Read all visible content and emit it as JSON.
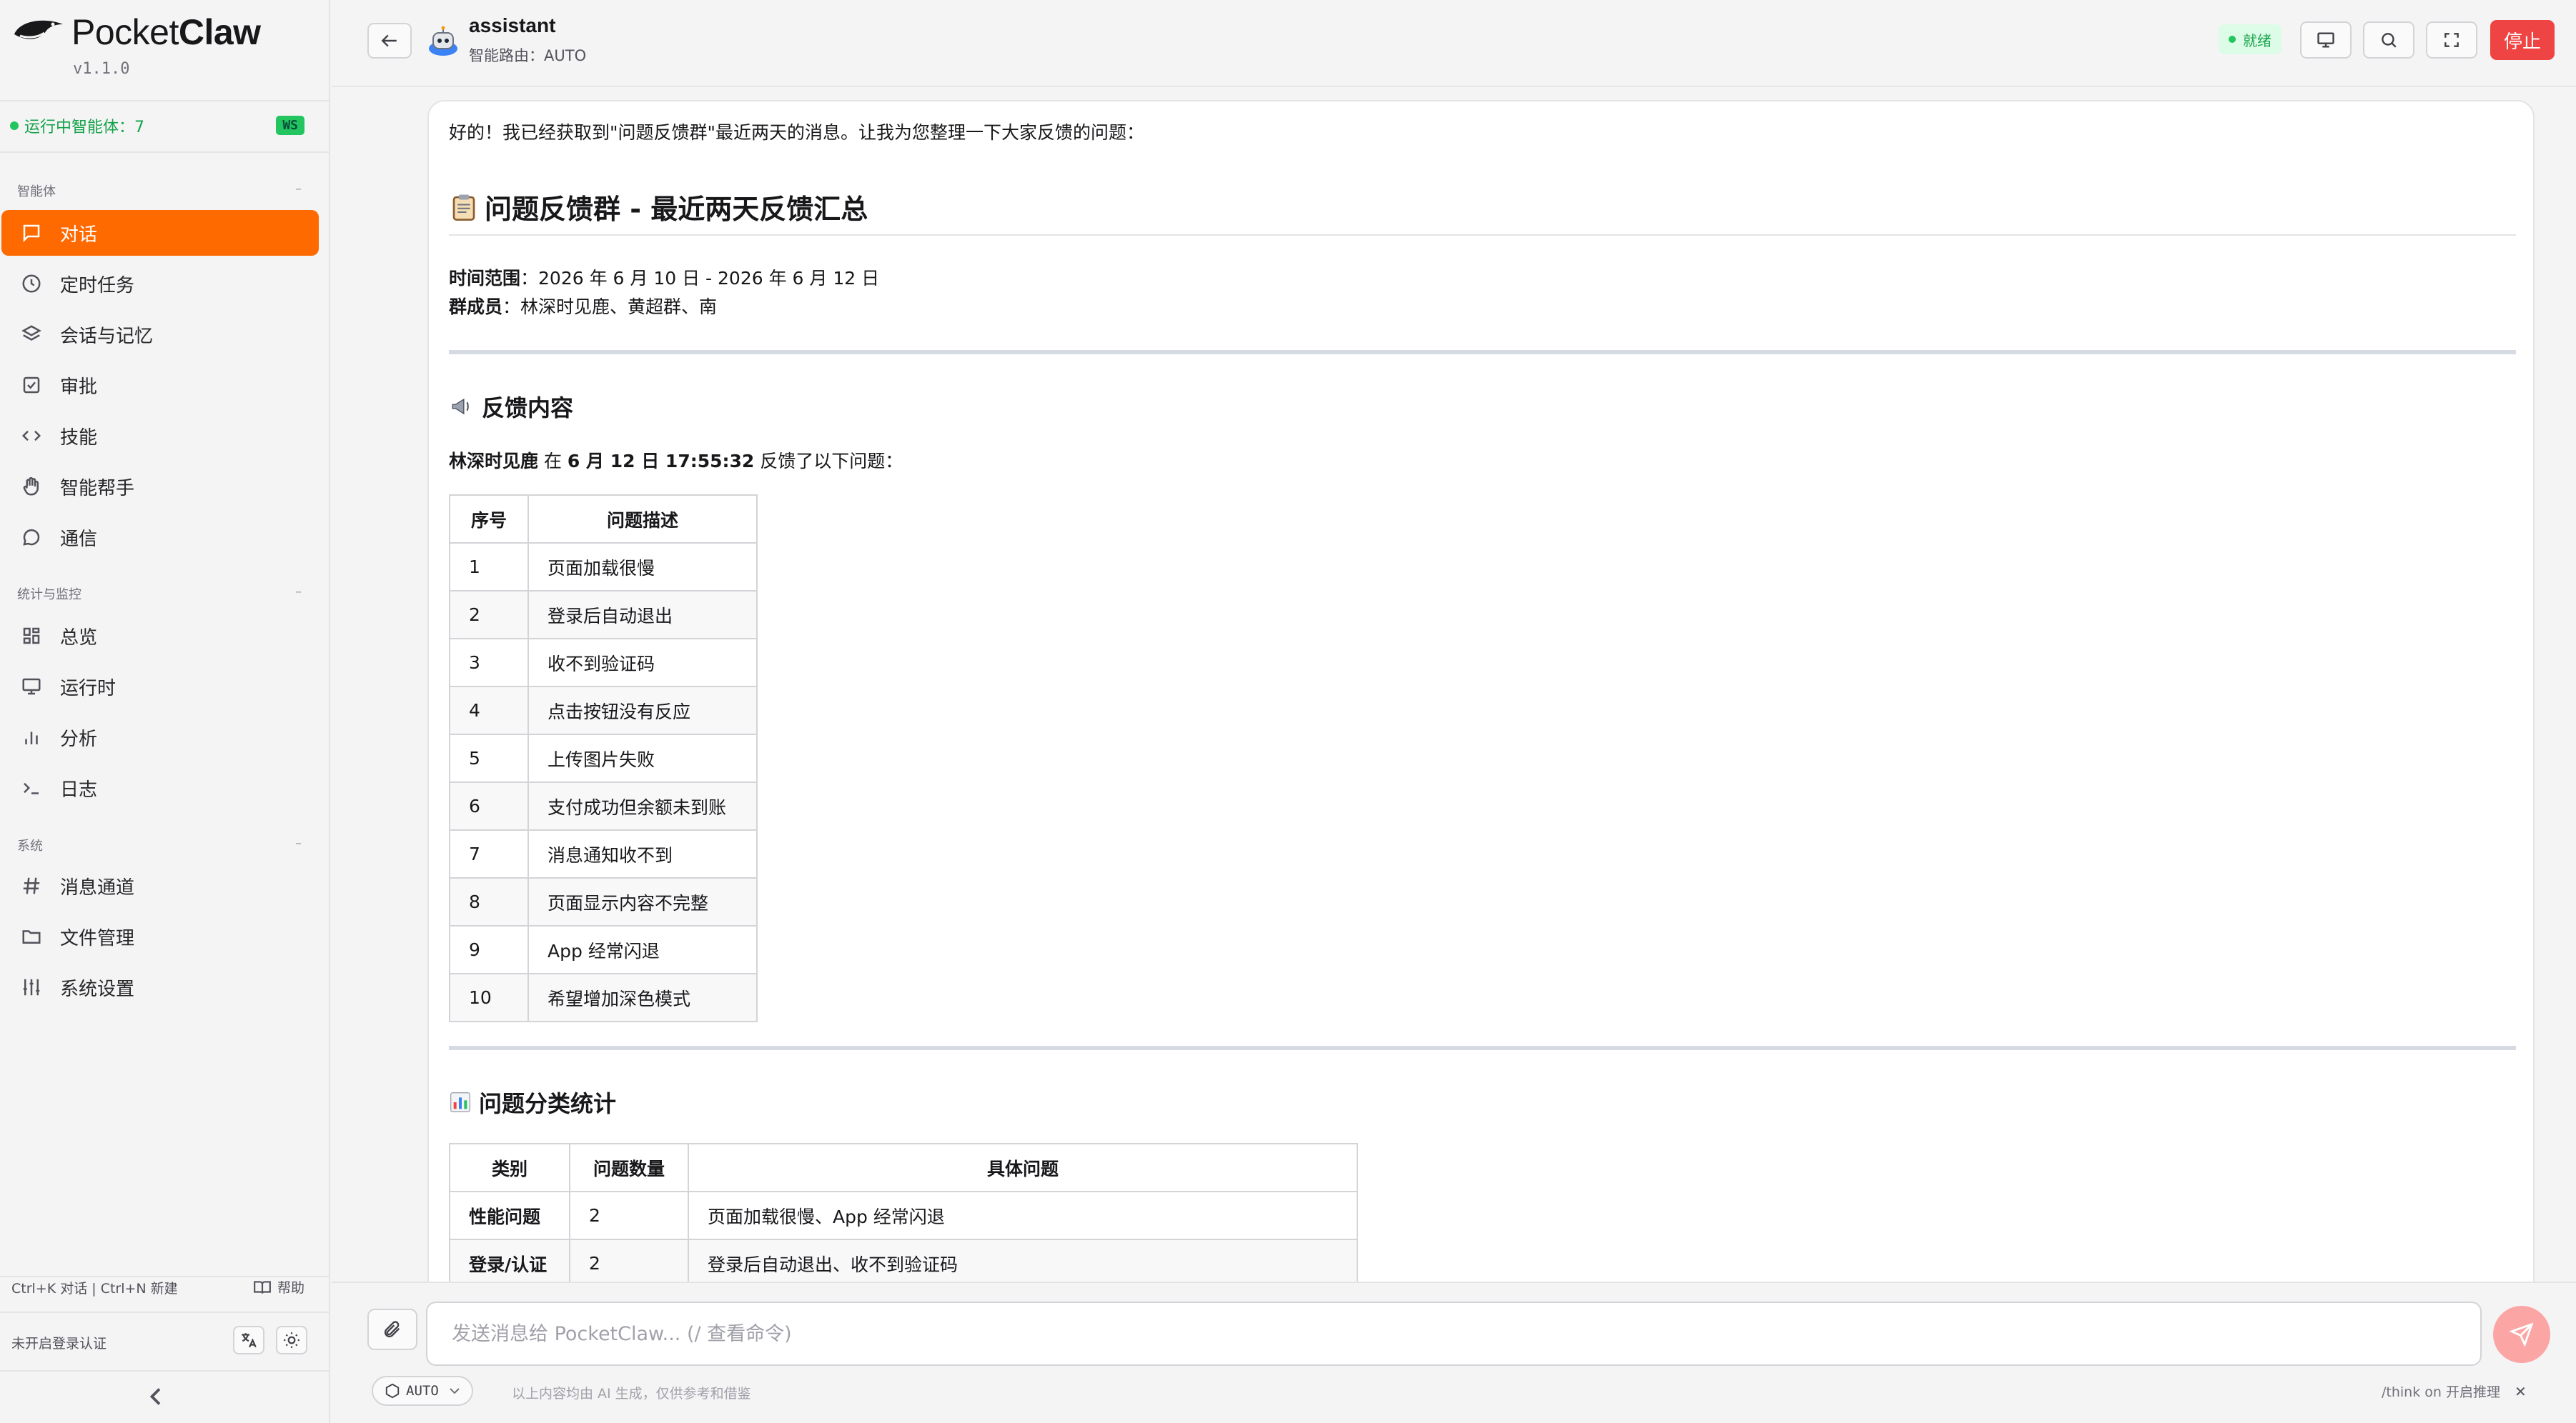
{
  "brand": {
    "name_light": "Pocket",
    "name_bold": "Claw",
    "version": "v1.1.0"
  },
  "sidebar": {
    "running_label": "运行中智能体：7",
    "ws_badge": "WS",
    "sections": [
      {
        "title": "智能体",
        "items": [
          {
            "label": "对话",
            "icon": "message-icon",
            "active": true
          },
          {
            "label": "定时任务",
            "icon": "clock-icon"
          },
          {
            "label": "会话与记忆",
            "icon": "layers-icon"
          },
          {
            "label": "审批",
            "icon": "checkbox-icon"
          },
          {
            "label": "技能",
            "icon": "code-icon"
          },
          {
            "label": "智能帮手",
            "icon": "hand-icon"
          },
          {
            "label": "通信",
            "icon": "chat-bubble-icon"
          }
        ]
      },
      {
        "title": "统计与监控",
        "items": [
          {
            "label": "总览",
            "icon": "grid-icon"
          },
          {
            "label": "运行时",
            "icon": "monitor-icon"
          },
          {
            "label": "分析",
            "icon": "bar-chart-icon"
          },
          {
            "label": "日志",
            "icon": "terminal-icon"
          }
        ]
      },
      {
        "title": "系统",
        "items": [
          {
            "label": "消息通道",
            "icon": "hash-icon"
          },
          {
            "label": "文件管理",
            "icon": "folder-icon"
          },
          {
            "label": "系统设置",
            "icon": "sliders-icon"
          }
        ]
      }
    ],
    "shortcuts": "Ctrl+K 对话 | Ctrl+N 新建",
    "help_label": "帮助",
    "login_status": "未开启登录认证"
  },
  "header": {
    "agent_name": "assistant",
    "route": "智能路由：AUTO",
    "status": "就绪",
    "stop_label": "停止"
  },
  "message": {
    "intro": "好的！我已经获取到\"问题反馈群\"最近两天的消息。让我为您整理一下大家反馈的问题：",
    "title": "问题反馈群 - 最近两天反馈汇总",
    "time_range_label": "时间范围",
    "time_range_value": "：2026 年 6 月 10 日 - 2026 年 6 月 12 日",
    "members_label": "群成员",
    "members_value": "：林深时见鹿、黄超群、南",
    "section_feedback": "反馈内容",
    "feedback_user": "林深时见鹿",
    "feedback_mid": " 在 ",
    "feedback_time": "6 月 12 日 17:55:32",
    "feedback_tail": " 反馈了以下问题：",
    "issues_headers": [
      "序号",
      "问题描述"
    ],
    "issues": [
      [
        "1",
        "页面加载很慢"
      ],
      [
        "2",
        "登录后自动退出"
      ],
      [
        "3",
        "收不到验证码"
      ],
      [
        "4",
        "点击按钮没有反应"
      ],
      [
        "5",
        "上传图片失败"
      ],
      [
        "6",
        "支付成功但余额未到账"
      ],
      [
        "7",
        "消息通知收不到"
      ],
      [
        "8",
        "页面显示内容不完整"
      ],
      [
        "9",
        "App 经常闪退"
      ],
      [
        "10",
        "希望增加深色模式"
      ]
    ],
    "section_stats": "问题分类统计",
    "stats_headers": [
      "类别",
      "问题数量",
      "具体问题"
    ],
    "stats": [
      [
        "性能问题",
        "2",
        "页面加载很慢、App 经常闪退"
      ],
      [
        "登录/认证",
        "2",
        "登录后自动退出、收不到验证码"
      ]
    ]
  },
  "input": {
    "placeholder": "发送消息给 PocketClaw... (/ 查看命令)",
    "model": "AUTO",
    "disclaimer": "以上内容均由 AI 生成，仅供参考和借鉴",
    "think_hint": "/think on 开启推理"
  },
  "colors": {
    "accent": "#ff6a00",
    "stop": "#ef4444",
    "ready": "#22c55e"
  }
}
